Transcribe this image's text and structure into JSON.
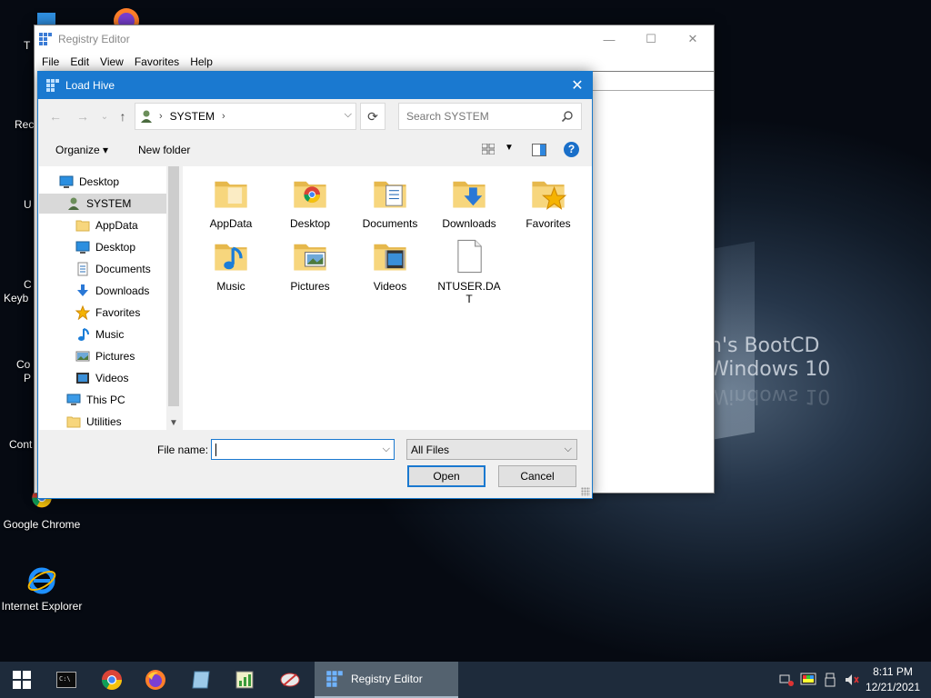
{
  "desktop": {
    "icons": [
      {
        "label": "T",
        "icon": "recycle-bin-icon"
      },
      {
        "label": "Rec",
        "icon": "recycle-icon"
      },
      {
        "label": "U",
        "icon": "utility-icon"
      },
      {
        "label": "C\nKeyb",
        "icon": "keyboard-icon"
      },
      {
        "label": "Co\nP",
        "icon": "control-panel-icon"
      },
      {
        "label": "Cont",
        "icon": "control-icon"
      },
      {
        "label": "Google Chrome",
        "icon": "chrome-icon"
      },
      {
        "label": "Internet Explorer",
        "icon": "ie-icon"
      }
    ],
    "wallpaper_text": [
      "n's BootCD",
      "Windows 10"
    ]
  },
  "registry_window": {
    "title": "Registry Editor",
    "menu": [
      "File",
      "Edit",
      "View",
      "Favorites",
      "Help"
    ],
    "caption_buttons": {
      "minimize": "—",
      "maximize": "☐",
      "close": "✕"
    }
  },
  "dialog": {
    "title": "Load Hive",
    "close": "✕",
    "nav": {
      "back": "←",
      "forward": "→",
      "recent": "⌄",
      "up": "↑"
    },
    "address": {
      "crumb_separator": "›",
      "crumb": "SYSTEM",
      "trailing": "›"
    },
    "refresh": "⟳",
    "search_placeholder": "Search SYSTEM",
    "toolbar": {
      "organize": "Organize ▾",
      "new_folder": "New folder",
      "help": "?"
    },
    "nav_pane": [
      {
        "label": "Desktop",
        "icon": "desktop-icon",
        "level": 0
      },
      {
        "label": "SYSTEM",
        "icon": "user-icon",
        "level": 1,
        "selected": true
      },
      {
        "label": "AppData",
        "icon": "folder-icon",
        "level": 2
      },
      {
        "label": "Desktop",
        "icon": "desktop-icon",
        "level": 2
      },
      {
        "label": "Documents",
        "icon": "documents-icon",
        "level": 2
      },
      {
        "label": "Downloads",
        "icon": "downloads-icon",
        "level": 2
      },
      {
        "label": "Favorites",
        "icon": "star-icon",
        "level": 2
      },
      {
        "label": "Music",
        "icon": "music-icon",
        "level": 2
      },
      {
        "label": "Pictures",
        "icon": "pictures-icon",
        "level": 2
      },
      {
        "label": "Videos",
        "icon": "videos-icon",
        "level": 2
      },
      {
        "label": "This PC",
        "icon": "computer-icon",
        "level": 1
      },
      {
        "label": "Utilities",
        "icon": "folder-icon",
        "level": 1
      }
    ],
    "files": [
      {
        "label": "AppData",
        "type": "folder-plain"
      },
      {
        "label": "Desktop",
        "type": "folder-chrome"
      },
      {
        "label": "Documents",
        "type": "folder-documents"
      },
      {
        "label": "Downloads",
        "type": "folder-downloads"
      },
      {
        "label": "Favorites",
        "type": "folder-favorites"
      },
      {
        "label": "Music",
        "type": "folder-music"
      },
      {
        "label": "Pictures",
        "type": "folder-pictures"
      },
      {
        "label": "Videos",
        "type": "folder-videos"
      },
      {
        "label": "NTUSER.DA\nT",
        "type": "file"
      }
    ],
    "file_name_label": "File name:",
    "file_name_value": "",
    "file_type": "All Files",
    "open_label": "Open",
    "cancel_label": "Cancel"
  },
  "taskbar": {
    "active_label": "Registry Editor",
    "time": "8:11 PM",
    "date": "12/21/2021"
  },
  "colors": {
    "dialog_accent": "#1a79d0",
    "folder": "#f4d27a",
    "taskbar": "#1e2b3b"
  }
}
